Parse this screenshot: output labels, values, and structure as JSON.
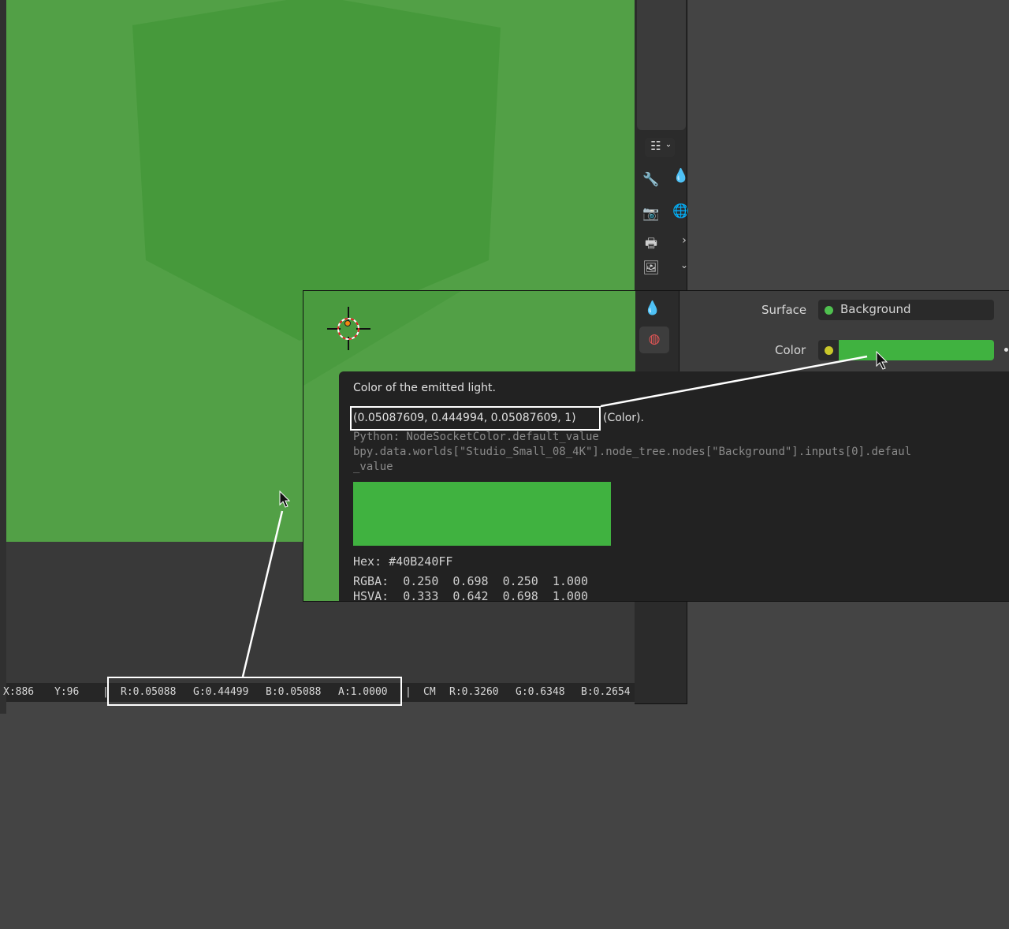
{
  "status_bar": {
    "x": "X:886",
    "y": "Y:96",
    "sep1": "|",
    "r": "R:0.05088",
    "g": "G:0.44499",
    "b": "B:0.05088",
    "a": "A:1.0000",
    "sep2": "|",
    "cm": "CM",
    "cm_r": "R:0.3260",
    "cm_g": "G:0.6348",
    "cm_b": "B:0.2654"
  },
  "properties": {
    "surface_label": "Surface",
    "surface_value": "Background",
    "color_label": "Color",
    "color_swatch": "#40B240"
  },
  "tooltip": {
    "description": "Color of the emitted light.",
    "value": "(0.05087609, 0.444994, 0.05087609, 1)",
    "value_type": "(Color).",
    "python_line": "Python: NodeSocketColor.default_value",
    "path_line1": "bpy.data.worlds[\"Studio_Small_08_4K\"].node_tree.nodes[\"Background\"].inputs[0].defaul",
    "path_line2": "_value",
    "swatch_color": "#40B240",
    "hex": "Hex: #40B240FF",
    "rgba": "RGBA:  0.250  0.698  0.250  1.000",
    "hsva": "HSVA:  0.333  0.642  0.698  1.000"
  },
  "colors": {
    "viewport_green": "#52a046",
    "surface_socket": "#4fc04f",
    "color_socket": "#c9c72a",
    "world_tab_active": "#e05555"
  }
}
